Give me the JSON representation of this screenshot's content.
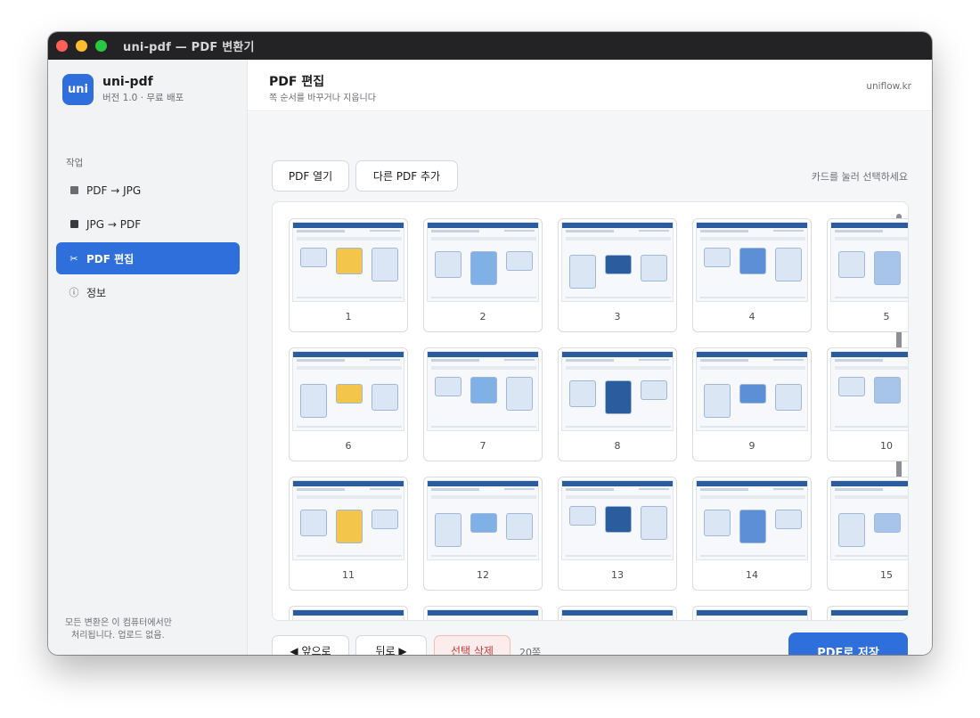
{
  "window": {
    "title": "uni-pdf — PDF 변환기"
  },
  "brand": {
    "logo_text": "uni",
    "name": "uni-pdf",
    "version": "버전 1.0 · 무료 배포"
  },
  "sidebar": {
    "section_label": "작업",
    "items": [
      {
        "label": "PDF → JPG",
        "icon": "document-icon",
        "active": false
      },
      {
        "label": "JPG → PDF",
        "icon": "image-icon",
        "active": false
      },
      {
        "label": "PDF 편집",
        "icon": "scissors-icon",
        "active": true
      },
      {
        "label": "정보",
        "icon": "info-icon",
        "active": false
      }
    ],
    "footer_line1": "모든 변환은 이 컴퓨터에서만",
    "footer_line2": "처리됩니다. 업로드 없음."
  },
  "header": {
    "title": "PDF 편집",
    "subtitle": "쪽 순서를 바꾸거나 지웁니다",
    "site": "uniflow.kr"
  },
  "toolbar": {
    "open_label": "PDF 열기",
    "add_label": "다른 PDF 추가",
    "hint": "카드를 눌러 선택하세요"
  },
  "pages": [
    "1",
    "2",
    "3",
    "4",
    "5",
    "6",
    "7",
    "8",
    "9",
    "10",
    "11",
    "12",
    "13",
    "14",
    "15"
  ],
  "footer": {
    "prev_label": "◀ 앞으로",
    "next_label": "뒤로 ▶",
    "delete_label": "선택 삭제",
    "page_count": "20쪽",
    "save_label": "PDF로 저장"
  },
  "colors": {
    "accent": "#2f6fdb",
    "danger": "#c13b3b",
    "titlebar": "#232325"
  }
}
